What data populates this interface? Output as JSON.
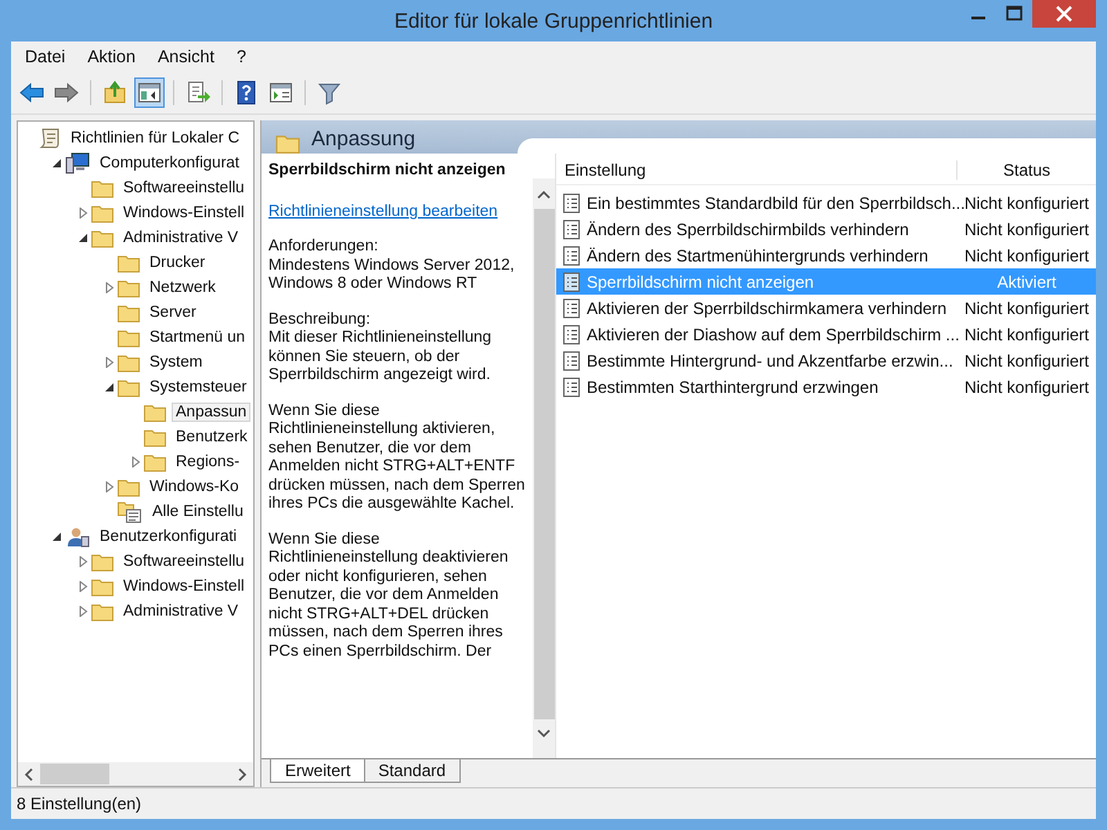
{
  "window": {
    "title": "Editor für lokale Gruppenrichtlinien"
  },
  "menu": [
    "Datei",
    "Aktion",
    "Ansicht",
    "?"
  ],
  "toolbar": [
    {
      "kind": "back",
      "pressed": false
    },
    {
      "kind": "forward",
      "pressed": false
    },
    {
      "kind": "separator"
    },
    {
      "kind": "up",
      "pressed": false
    },
    {
      "kind": "pane",
      "pressed": true
    },
    {
      "kind": "separator"
    },
    {
      "kind": "export",
      "pressed": false
    },
    {
      "kind": "separator"
    },
    {
      "kind": "help",
      "pressed": false
    },
    {
      "kind": "properties",
      "pressed": false
    },
    {
      "kind": "separator"
    },
    {
      "kind": "filter",
      "pressed": false
    }
  ],
  "tree": [
    {
      "label": "Richtlinien für Lokaler C",
      "kind": "policy",
      "selected": false,
      "children": [
        {
          "label": "Computerkonfigurat",
          "kind": "computer",
          "expanded": true,
          "selected": false,
          "children": [
            {
              "label": "Softwareeinstellu",
              "kind": "folder",
              "selected": false
            },
            {
              "label": "Windows-Einstell",
              "kind": "folder",
              "expanded": false,
              "selected": false
            },
            {
              "label": "Administrative V",
              "kind": "folder",
              "expanded": true,
              "selected": false,
              "children": [
                {
                  "label": "Drucker",
                  "kind": "folder",
                  "selected": false
                },
                {
                  "label": "Netzwerk",
                  "kind": "folder",
                  "expanded": false,
                  "selected": false
                },
                {
                  "label": "Server",
                  "kind": "folder",
                  "selected": false
                },
                {
                  "label": "Startmenü un",
                  "kind": "folder",
                  "selected": false
                },
                {
                  "label": "System",
                  "kind": "folder",
                  "expanded": false,
                  "selected": false
                },
                {
                  "label": "Systemsteuer",
                  "kind": "folder",
                  "expanded": true,
                  "selected": false,
                  "children": [
                    {
                      "label": "Anpassun",
                      "kind": "folder",
                      "selected": true
                    },
                    {
                      "label": "Benutzerk",
                      "kind": "folder",
                      "selected": false
                    },
                    {
                      "label": "Regions-",
                      "kind": "folder",
                      "expanded": false,
                      "selected": false
                    }
                  ]
                },
                {
                  "label": "Windows-Ko",
                  "kind": "folder",
                  "expanded": false,
                  "selected": false
                },
                {
                  "label": "Alle Einstellu",
                  "kind": "all-settings",
                  "selected": false
                }
              ]
            }
          ]
        },
        {
          "label": "Benutzerkonfigurati",
          "kind": "user",
          "expanded": true,
          "selected": false,
          "children": [
            {
              "label": "Softwareeinstellu",
              "kind": "folder",
              "expanded": false,
              "selected": false
            },
            {
              "label": "Windows-Einstell",
              "kind": "folder",
              "expanded": false,
              "selected": false
            },
            {
              "label": "Administrative V",
              "kind": "folder",
              "expanded": false,
              "selected": false
            }
          ]
        }
      ]
    }
  ],
  "panel": {
    "title": "Anpassung"
  },
  "description": {
    "title": "Sperrbildschirm nicht anzeigen",
    "link": "Richtlinieneinstellung bearbeiten",
    "paragraphs": [
      "Anforderungen:\nMindestens Windows Server 2012, Windows 8 oder Windows RT",
      "Beschreibung:\nMit dieser Richtlinieneinstellung können Sie steuern, ob der Sperrbildschirm angezeigt wird.",
      "Wenn Sie diese Richtlinieneinstellung aktivieren, sehen Benutzer, die vor dem Anmelden nicht STRG+ALT+ENTF drücken müssen, nach dem Sperren ihres PCs die ausgewählte Kachel.",
      "Wenn Sie diese Richtlinieneinstellung deaktivieren oder nicht konfigurieren, sehen Benutzer, die vor dem Anmelden nicht STRG+ALT+DEL drücken müssen, nach dem Sperren ihres PCs einen Sperrbildschirm. Der"
    ]
  },
  "table": {
    "columns": [
      "Einstellung",
      "Status"
    ],
    "rows": [
      {
        "name": "Ein bestimmtes Standardbild für den Sperrbildsch...",
        "status": "Nicht konfiguriert",
        "selected": false
      },
      {
        "name": "Ändern des Sperrbildschirmbilds verhindern",
        "status": "Nicht konfiguriert",
        "selected": false
      },
      {
        "name": "Ändern des Startmenühintergrunds verhindern",
        "status": "Nicht konfiguriert",
        "selected": false
      },
      {
        "name": "Sperrbildschirm nicht anzeigen",
        "status": "Aktiviert",
        "selected": true
      },
      {
        "name": "Aktivieren der Sperrbildschirmkamera verhindern",
        "status": "Nicht konfiguriert",
        "selected": false
      },
      {
        "name": "Aktivieren der Diashow auf dem Sperrbildschirm ...",
        "status": "Nicht konfiguriert",
        "selected": false
      },
      {
        "name": "Bestimmte Hintergrund- und Akzentfarbe erzwin...",
        "status": "Nicht konfiguriert",
        "selected": false
      },
      {
        "name": "Bestimmten Starthintergrund erzwingen",
        "status": "Nicht konfiguriert",
        "selected": false
      }
    ]
  },
  "tabs": [
    {
      "label": "Erweitert",
      "selected": true
    },
    {
      "label": "Standard",
      "selected": false
    }
  ],
  "status_bar": {
    "text": "8 Einstellung(en)"
  }
}
